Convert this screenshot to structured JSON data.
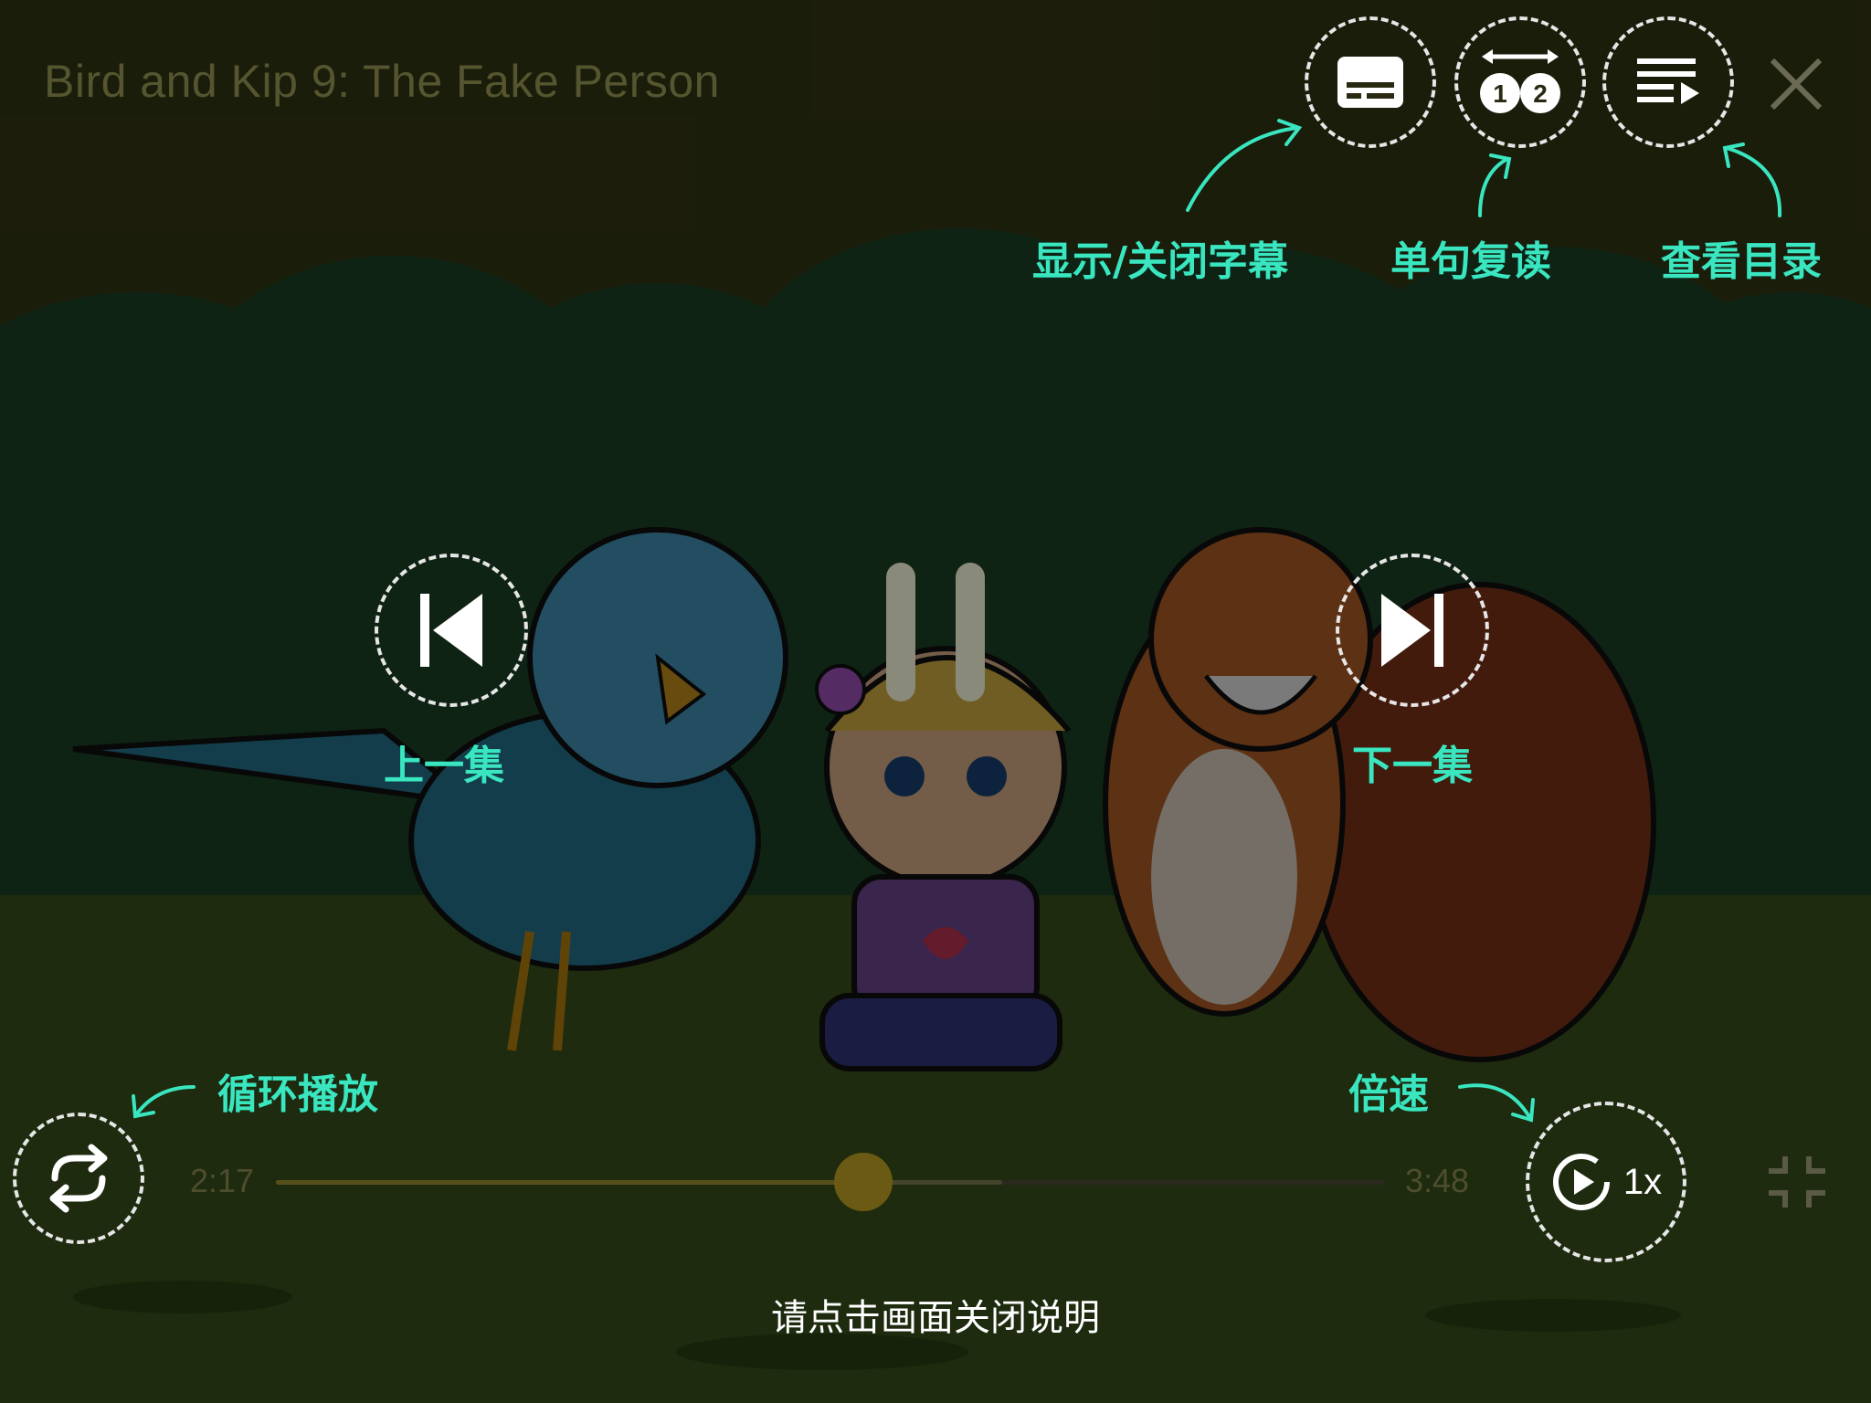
{
  "video": {
    "title": "Bird and Kip 9: The Fake Person",
    "current_time": "2:17",
    "duration": "3:48",
    "progress": 0.53,
    "buffered": 0.655,
    "speed": "1x"
  },
  "hints": {
    "subtitles": "显示/关闭字幕",
    "repeat_sentence": "单句复读",
    "catalog": "查看目录",
    "previous": "上一集",
    "next": "下一集",
    "loop": "循环播放",
    "speed": "倍速"
  },
  "footer": {
    "dismiss_text": "请点击画面关闭说明"
  },
  "icons": {
    "subtitles": "subtitles-icon",
    "repeat": "repeat-sentence-icon",
    "catalog": "playlist-icon",
    "close": "close-icon",
    "previous": "skip-previous-icon",
    "pause": "pause-icon",
    "next": "skip-next-icon",
    "loop": "loop-icon",
    "speed": "speed-icon",
    "fullscreen": "exit-fullscreen-icon"
  },
  "colors": {
    "hint": "#39e6c0",
    "overlay": "#2a2a12"
  }
}
